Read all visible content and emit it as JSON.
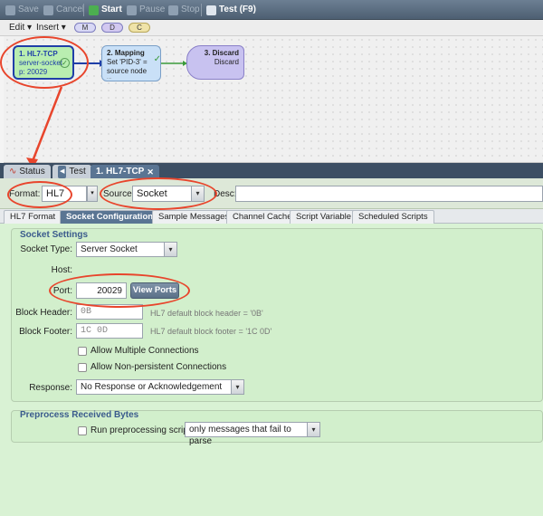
{
  "toolbar": {
    "save": "Save",
    "cancel": "Cancel",
    "start": "Start",
    "pause": "Pause",
    "stop": "Stop",
    "test": "Test (F9)"
  },
  "toolbar2": {
    "edit": "Edit",
    "insert": "Insert",
    "pills": [
      "M",
      "D",
      "C"
    ]
  },
  "nodes": [
    {
      "title": "1. HL7-TCP",
      "line1": "server-socket",
      "line2": "p: 20029"
    },
    {
      "title": "2. Mapping",
      "line1": "Set 'PID-3' =",
      "line2": "source node",
      "line3": "...."
    },
    {
      "title": "3. Discard",
      "line1": "Discard"
    }
  ],
  "tabs": {
    "status": "Status",
    "test": "Test",
    "active": "1. HL7-TCP"
  },
  "header": {
    "format_label": "Format:",
    "format_value": "HL7",
    "source_label": "Source:",
    "source_value": "Socket",
    "desc_label": "Desc:"
  },
  "subtabs": [
    "HL7 Format",
    "Socket Configuration",
    "Sample Messages",
    "Channel Cache",
    "Script Variable",
    "Scheduled Scripts"
  ],
  "socket": {
    "title": "Socket Settings",
    "type_label": "Socket Type:",
    "type_value": "Server Socket",
    "host_label": "Host:",
    "port_label": "Port:",
    "port_value": "20029",
    "view_ports": "View Ports",
    "block_header_label": "Block Header:",
    "block_header_value": "0B",
    "block_header_hint": "HL7 default block header = '0B'",
    "block_footer_label": "Block Footer:",
    "block_footer_value": "1C 0D",
    "block_footer_hint": "HL7 default block footer = '1C 0D'",
    "allow_multiple": "Allow Multiple Connections",
    "allow_nonpersistent": "Allow Non-persistent Connections",
    "response_label": "Response:",
    "response_value": "No Response or Acknowledgement"
  },
  "preprocess": {
    "title": "Preprocess Received Bytes",
    "run_label": "Run preprocessing script on",
    "run_value": "only messages that fail to parse"
  },
  "colors": {
    "annotation": "#e8452c",
    "panel_green": "#d9f2d4",
    "toolbar_blue": "#4d5f72"
  }
}
